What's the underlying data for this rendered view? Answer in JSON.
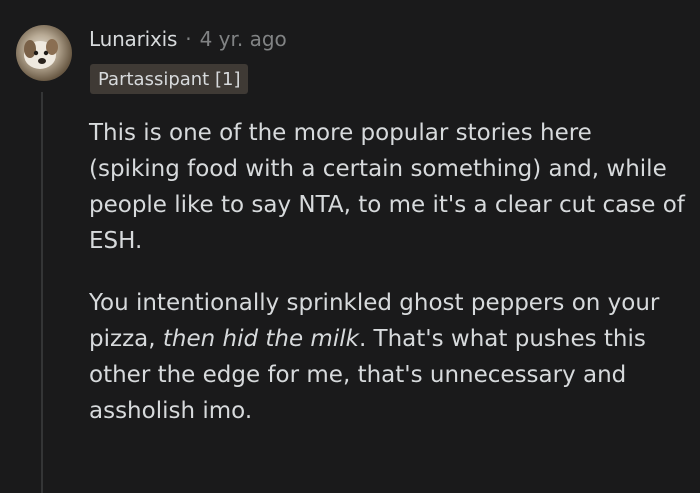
{
  "comment": {
    "username": "Lunarixis",
    "separator": "·",
    "timestamp": "4 yr. ago",
    "flair": "Partassipant [1]",
    "paragraph_1": "This is one of the more popular stories here (spiking food with a certain something) and, while people like to say NTA, to me it's a clear cut case of ESH.",
    "paragraph_2_before": "You intentionally sprinkled ghost peppers on your pizza, ",
    "paragraph_2_emphasis": "then hid the milk",
    "paragraph_2_after": ". That's what pushes this other the edge for me, that's unnecessary and assholish imo."
  },
  "colors": {
    "background": "#1a1a1b",
    "text": "#d7dadc",
    "meta": "#818384",
    "flair_bg": "#3f3a35",
    "thread_line": "#343536"
  }
}
